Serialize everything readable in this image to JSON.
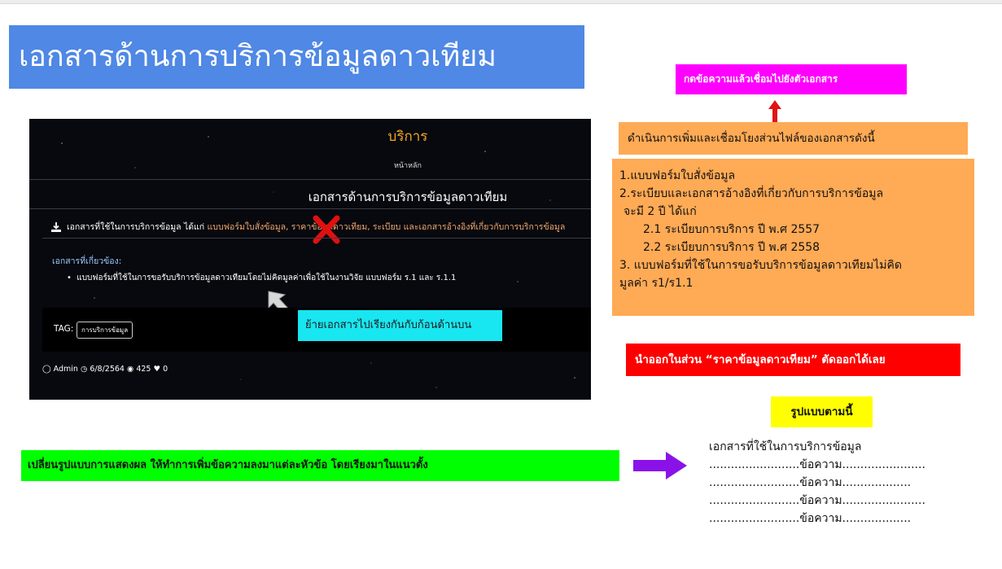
{
  "main_title": "เอกสารด้านการบริการข้อมูลดาวเทียม",
  "screenshot": {
    "service_title": "บริการ",
    "breadcrumb": "หน้าหลัก",
    "doc_title": "เอกสารด้านการบริการข้อมูลดาวเทียม",
    "download_row": {
      "prefix": "เอกสารที่ใช้ในการบริการข้อมูล ได้แก่",
      "links": "แบบฟอร์มใบสั่งข้อมูล, ราคาข้อมูลดาวเทียม, ระเบียบ และเอกสารอ้างอิงที่เกี่ยวกับการบริการข้อมูล"
    },
    "related_heading": "เอกสารที่เกี่ยวข้อง:",
    "related_item": "แบบฟอร์มที่ใช้ในการขอรับบริการข้อมูลดาวเทียมโดยไม่คิดมูลค่าเพื่อใช้ในงานวิจัย แบบฟอร์ม ร.1 และ ร.1.1",
    "tag_label": "TAG:",
    "tag_chip": "การบริการข้อมูล",
    "meta": {
      "author": "Admin",
      "date": "6/8/2564",
      "views": "425",
      "likes": "0"
    }
  },
  "notes": {
    "cyan": "ย้ายเอกสารไปเรียงกันกับก้อนด้านบน",
    "magenta": "กดข้อความแล้วเชื่อมไปยังตัวเอกสาร",
    "peach": "ดำเนินการเพิ่มและเชื่อมโยงส่วนไฟล์ของเอกสารดังนี้",
    "orange_lines": [
      "1.แบบฟอร์มใบสั่งข้อมูล",
      "2.ระเบียบและเอกสารอ้างอิงที่เกี่ยวกับการบริการข้อมูล",
      "จะมี 2 ปี ได้แก่",
      "2.1 ระเบียบการบริการ  ปี พ.ศ 2557",
      "2.2 ระเบียบการบริการ  ปี พ.ศ 2558",
      "3. แบบฟอร์มที่ใช้ในการขอรับบริการข้อมูลดาวเทียมไม่คิด",
      "มูลค่า  ร1/ร1.1"
    ],
    "red": "นำออกในส่วน  “ราคาข้อมูลดาวเทียม” ตัดออกได้เลย",
    "yellow": "รูปแบบตามนี้",
    "green": "เปลี่ยนรูปแบบการแสดงผล ให้ทำการเพิ่มข้อความลงมาแต่ละหัวข้อ  โดยเรียงมาในแนวตั้ง"
  },
  "format_example": {
    "heading": "เอกสารที่ใช้ในการบริการข้อมูล",
    "lines": [
      ".........................ข้อความ.......................",
      ".........................ข้อความ...................",
      ".........................ข้อความ.......................",
      ".........................ข้อความ..................."
    ]
  },
  "colors": {
    "title_bg": "#4f88e5",
    "cyan": "#18e6f0",
    "magenta": "#ff00ff",
    "orange": "#ffaa55",
    "red": "#ff0000",
    "yellow": "#ffff00",
    "green": "#00ff00",
    "arrow_purple": "#8a12e8"
  }
}
